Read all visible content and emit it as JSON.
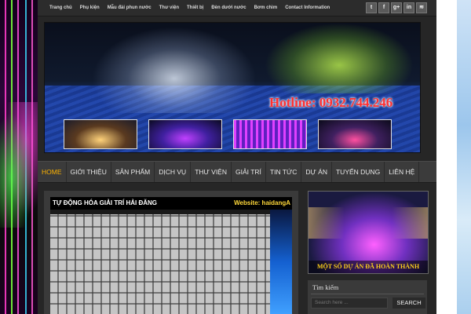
{
  "topnav": [
    "Trang chủ",
    "Phụ kiện",
    "Mẫu đài phun nước",
    "Thư viện",
    "Thiết bị",
    "Đèn dưới nước",
    "Bơm chìm",
    "Contact Information"
  ],
  "social": [
    "twitter-icon",
    "facebook-icon",
    "google-plus-icon",
    "linkedin-icon",
    "rss-icon"
  ],
  "social_glyphs": [
    "t",
    "f",
    "g+",
    "in",
    "≋"
  ],
  "banner": {
    "hotline": "Hotline: 0932.744.246"
  },
  "mainnav": [
    "HOME",
    "GIỚI THIỆU",
    "SẢN PHẨM",
    "DỊCH VỤ",
    "THƯ VIỆN",
    "GIẢI TRÍ",
    "TIN TỨC",
    "DỰ ÁN",
    "TUYỂN DỤNG",
    "LIÊN HỆ"
  ],
  "mainnav_active": "HOME",
  "video": {
    "title": "TỰ ĐỘNG HÓA GIẢI TRÍ HẢI ĐĂNG",
    "website": "Website: haidangA"
  },
  "promo": {
    "caption": "MỘT SỐ DỰ ÁN ĐÃ HOÀN THÀNH"
  },
  "search": {
    "title": "Tìm kiếm",
    "placeholder": "Search here ...",
    "button": "SEARCH"
  },
  "colors": {
    "accent": "#ffb400",
    "hotline": "#ff3030",
    "caption": "#ffd21a"
  }
}
